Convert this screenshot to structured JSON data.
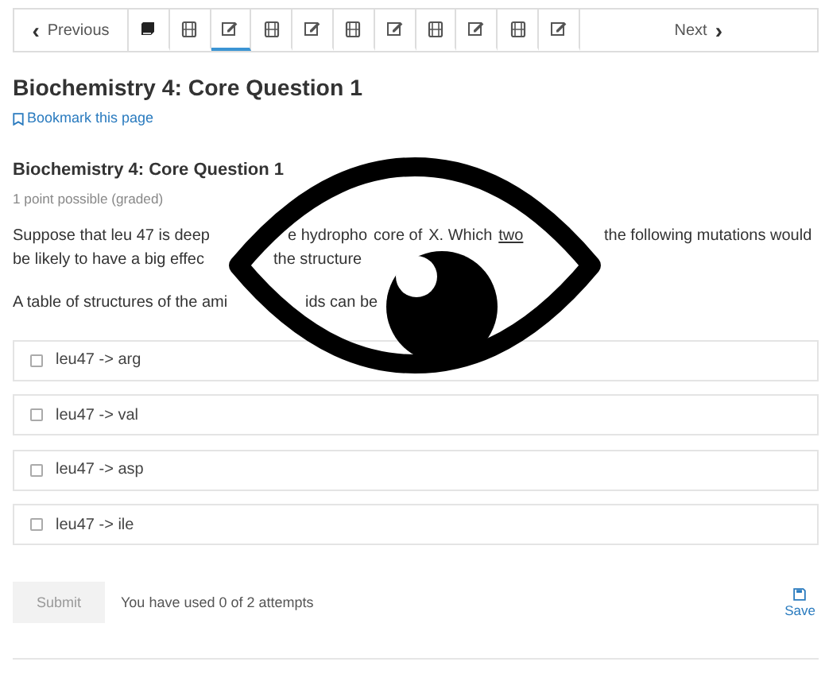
{
  "nav": {
    "previous": {
      "arrow": "‹",
      "label": "Previous"
    },
    "next": {
      "label": "Next",
      "arrow": "›"
    },
    "units": [
      {
        "kind": "book",
        "selected": false
      },
      {
        "kind": "video",
        "selected": false
      },
      {
        "kind": "problem",
        "selected": true
      },
      {
        "kind": "video",
        "selected": false
      },
      {
        "kind": "problem",
        "selected": false
      },
      {
        "kind": "video",
        "selected": false
      },
      {
        "kind": "problem",
        "selected": false
      },
      {
        "kind": "video",
        "selected": false
      },
      {
        "kind": "problem",
        "selected": false
      },
      {
        "kind": "video",
        "selected": false
      },
      {
        "kind": "problem",
        "selected": false
      }
    ]
  },
  "page_title": "Biochemistry 4: Core Question 1",
  "bookmark": "Bookmark this page",
  "problem": {
    "title": "Biochemistry 4: Core Question 1",
    "points": "1 point possible (graded)",
    "paragraphs": [
      [
        {
          "kind": "text",
          "text": "Suppose that leu 47 is deep"
        },
        {
          "kind": "text",
          "text": "e hydropho"
        },
        {
          "kind": "text",
          "text": "core of"
        },
        {
          "kind": "text",
          "text": "X. Which"
        },
        {
          "kind": "underlined",
          "text": "two"
        },
        {
          "kind": "text",
          "text": "the following mutations would"
        }
      ],
      [
        {
          "kind": "text",
          "text": "be likely to have a big effec"
        },
        {
          "kind": "text",
          "text": "the structure"
        }
      ],
      [
        {
          "kind": "text",
          "text": "A table of structures of the ami"
        },
        {
          "kind": "text",
          "text": "ids can be"
        }
      ]
    ],
    "choices": [
      {
        "label": "leu47 -> arg",
        "checked": false
      },
      {
        "label": "leu47 -> val",
        "checked": false
      },
      {
        "label": "leu47 -> asp",
        "checked": false
      },
      {
        "label": "leu47 -> ile",
        "checked": false
      }
    ],
    "submit": {
      "label": "Submit",
      "disabled": true
    },
    "attempts": "You have used 0 of 2 attempts",
    "save": "Save"
  }
}
